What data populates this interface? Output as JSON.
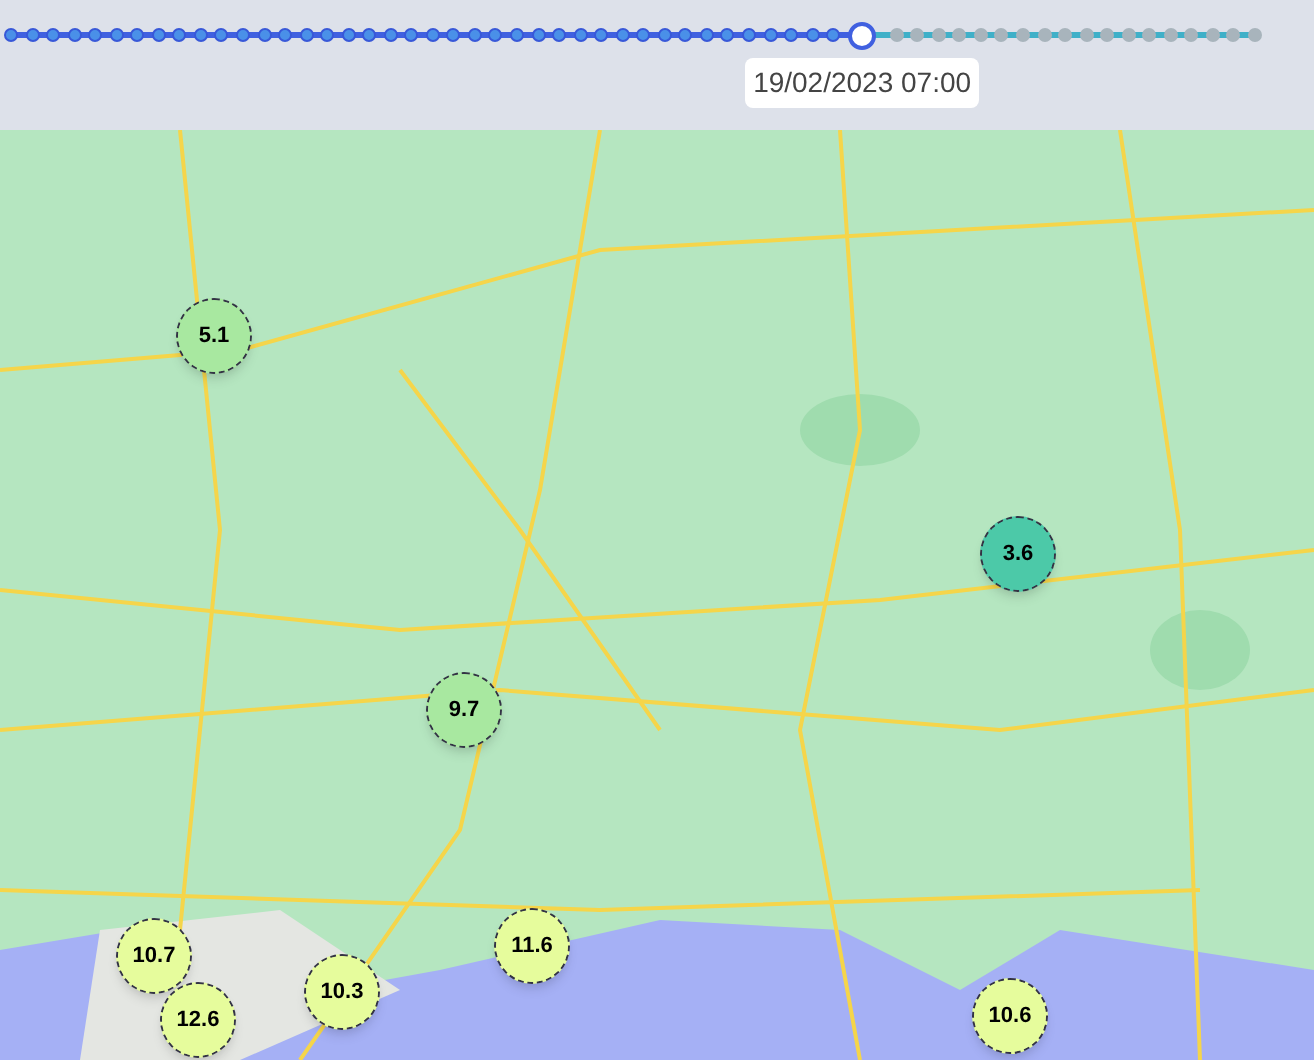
{
  "timeline": {
    "level": 0.685,
    "time_label": "19/02/2023 07:00"
  },
  "markers": [
    {
      "value": "5.1",
      "color": "#a8e8a0"
    },
    {
      "value": "9.7",
      "color": "#a8e8a0"
    },
    {
      "value": "3.6",
      "color": "#4cc9a8"
    },
    {
      "value": "10.7",
      "color": "#e6fc9c"
    },
    {
      "value": "12.6",
      "color": "#e6fc9c"
    },
    {
      "value": "10.3",
      "color": "#e6fc9c"
    },
    {
      "value": "11.6",
      "color": "#e6fc9c"
    },
    {
      "value": "10.6",
      "color": "#e6fc9c"
    }
  ]
}
